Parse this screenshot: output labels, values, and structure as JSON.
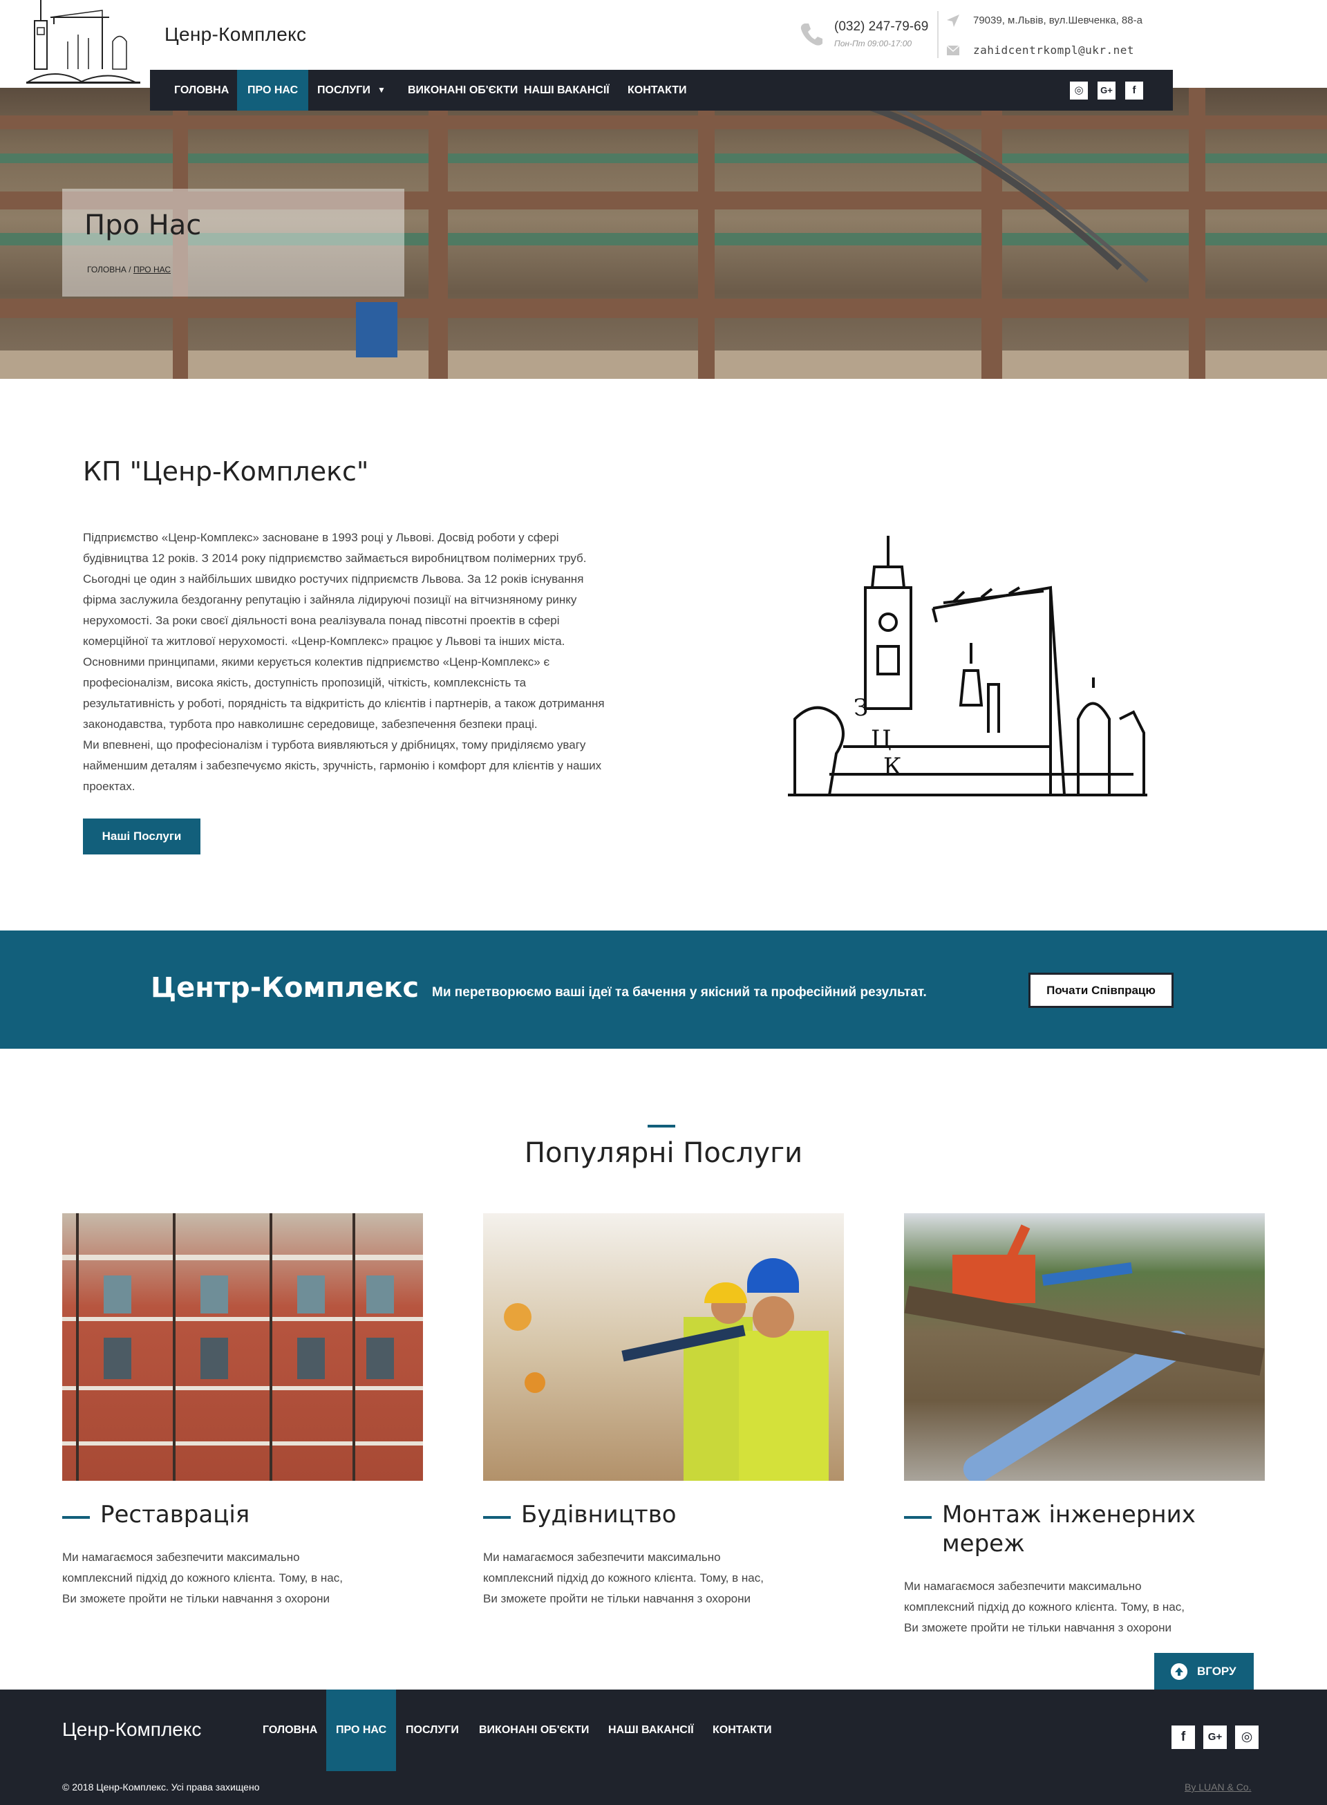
{
  "brand": {
    "name": "Ценр-Комплекс"
  },
  "contact": {
    "phone": "(032) 247-79-69",
    "hours": "Пон-Пт 09:00-17:00",
    "address": "79039, м.Львів, вул.Шевченка, 88-а",
    "email": "zahidcentrkompl@ukr.net"
  },
  "nav": {
    "items": [
      {
        "label": "ГОЛОВНА"
      },
      {
        "label": "ПРО НАС"
      },
      {
        "label": "ПОСЛУГИ"
      },
      {
        "label": "ВИКОНАНІ ОБ'ЄКТИ"
      },
      {
        "label": "НАШІ ВАКАНСІЇ"
      },
      {
        "label": "КОНТАКТИ"
      }
    ],
    "active": "ПРО НАС",
    "social": [
      {
        "icon": "instagram-icon",
        "glyph": "◎"
      },
      {
        "icon": "google-plus-icon",
        "glyph": "G+"
      },
      {
        "icon": "facebook-icon",
        "glyph": "f"
      }
    ]
  },
  "hero": {
    "title": "Про Нас",
    "breadcrumb": {
      "home": "ГОЛОВНА",
      "separator": "/",
      "current": "ПРО НАС"
    }
  },
  "about": {
    "heading": "КП \"Ценр-Комплекс\"",
    "lines": [
      "Підприємство «Ценр-Комплекс» засноване в 1993 році у Львові.  Досвід роботи у сфері",
      "будівництва 12 років. З 2014 року підприємство займається виробництвом полімерних труб.",
      "Сьогодні це один з найбільших швидко ростучих підприємств Львова. За 12 років існування",
      "фірма заслужила бездоганну репутацію і зайняла лідируючі позиції на вітчизняному ринку",
      "нерухомості. За роки своєї діяльності вона реалізувала понад півсотні проектів в сфері",
      "комерційної та житлової нерухомості. «Ценр-Комплекс» працює у Львові та інших міста.",
      "Основними принципами, якими керується колектив підприємство «Ценр-Комплекс» є",
      "професіоналізм, висока якість, доступність пропозицій, чіткість, комплексність та",
      "результативність у роботі, порядність та відкритість до клієнтів і партнерів, а також дотримання",
      "законодавства, турбота про навколишнє середовище, забезпечення безпеки праці.",
      "Ми впевнені, що професіоналізм і турбота виявляються у дрібницях, тому приділяємо увагу",
      "найменшим деталям і забезпечуємо якість, зручність, гармонію і комфорт для клієнтів у наших",
      "проектах."
    ],
    "button": "Наші Послуги",
    "illustration_letters": [
      "З",
      "Ц",
      "К"
    ]
  },
  "cta": {
    "brand": "Центр-Комплекс",
    "text": "Ми перетворюємо ваші ідеї та бачення у якісний та професійний результат.",
    "button": "Почати Співпрацю"
  },
  "services": {
    "title": "Популярні Послуги",
    "items": [
      {
        "title_lines": [
          "Реставрація"
        ],
        "desc_lines": [
          "Ми намагаємося забезпечити максимально",
          "комплексний підхід до кожного клієнта. Тому, в нас,",
          "Ви зможете пройти не тільки навчання з охорони"
        ]
      },
      {
        "title_lines": [
          "Будівництво"
        ],
        "desc_lines": [
          "Ми намагаємося забезпечити максимально",
          "комплексний підхід до кожного клієнта. Тому, в нас,",
          "Ви зможете пройти не тільки навчання з охорони"
        ]
      },
      {
        "title_lines": [
          "Монтаж інженерних",
          "мереж"
        ],
        "desc_lines": [
          "Ми намагаємося забезпечити максимально",
          "комплексний підхід до кожного клієнта. Тому, в нас,",
          "Ви зможете пройти не тільки навчання з охорони"
        ]
      }
    ]
  },
  "scroll_up": {
    "label": "ВГОРУ"
  },
  "footer": {
    "brand": "Ценр-Комплекс",
    "nav": [
      {
        "label": "ГОЛОВНА"
      },
      {
        "label": "ПРО НАС"
      },
      {
        "label": "ПОСЛУГИ"
      },
      {
        "label": "ВИКОНАНІ ОБ'ЄКТИ"
      },
      {
        "label": "НАШІ ВАКАНСІЇ"
      },
      {
        "label": "КОНТАКТИ"
      }
    ],
    "social": [
      {
        "icon": "facebook-icon",
        "glyph": "f"
      },
      {
        "icon": "google-plus-icon",
        "glyph": "G+"
      },
      {
        "icon": "instagram-icon",
        "glyph": "◎"
      }
    ],
    "copyright": "© 2018 Ценр-Комплекс. Усі права захищено",
    "credit": "By LUAN & Co."
  },
  "colors": {
    "accent": "#125f7b",
    "dark": "#1f232c"
  }
}
